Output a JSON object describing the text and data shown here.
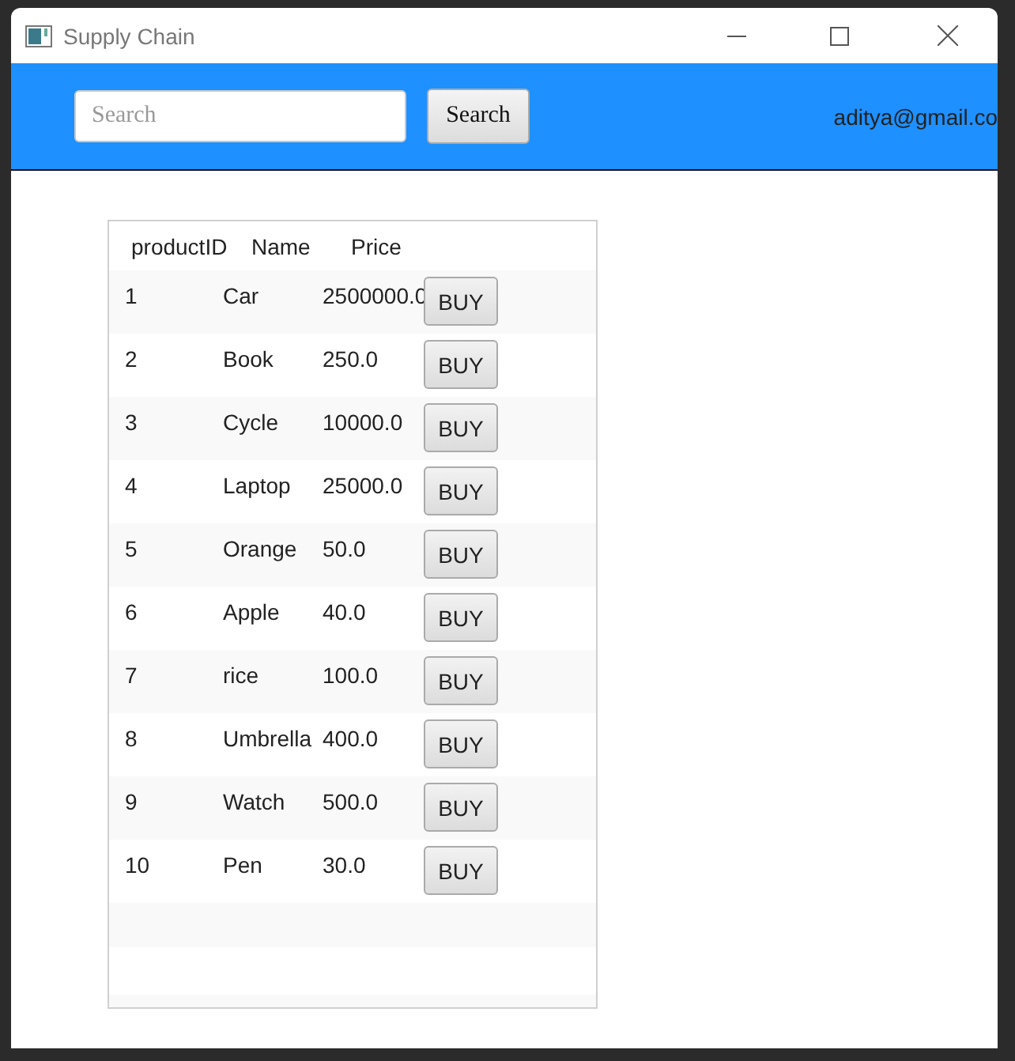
{
  "window": {
    "title": "Supply Chain"
  },
  "header": {
    "search": {
      "placeholder": "Search"
    },
    "search_button": "Search",
    "user_email": "aditya@gmail.co"
  },
  "table": {
    "columns": [
      "productID",
      "Name",
      "Price"
    ],
    "rows": [
      {
        "id": "1",
        "name": "Car",
        "price": "2500000.0",
        "action": "BUY"
      },
      {
        "id": "2",
        "name": "Book",
        "price": "250.0",
        "action": "BUY"
      },
      {
        "id": "3",
        "name": "Cycle",
        "price": "10000.0",
        "action": "BUY"
      },
      {
        "id": "4",
        "name": "Laptop",
        "price": "25000.0",
        "action": "BUY"
      },
      {
        "id": "5",
        "name": "Orange",
        "price": "50.0",
        "action": "BUY"
      },
      {
        "id": "6",
        "name": "Apple",
        "price": "40.0",
        "action": "BUY"
      },
      {
        "id": "7",
        "name": "rice",
        "price": "100.0",
        "action": "BUY"
      },
      {
        "id": "8",
        "name": "Umbrella",
        "price": "400.0",
        "action": "BUY"
      },
      {
        "id": "9",
        "name": "Watch",
        "price": "500.0",
        "action": "BUY"
      },
      {
        "id": "10",
        "name": "Pen",
        "price": "30.0",
        "action": "BUY"
      }
    ]
  }
}
